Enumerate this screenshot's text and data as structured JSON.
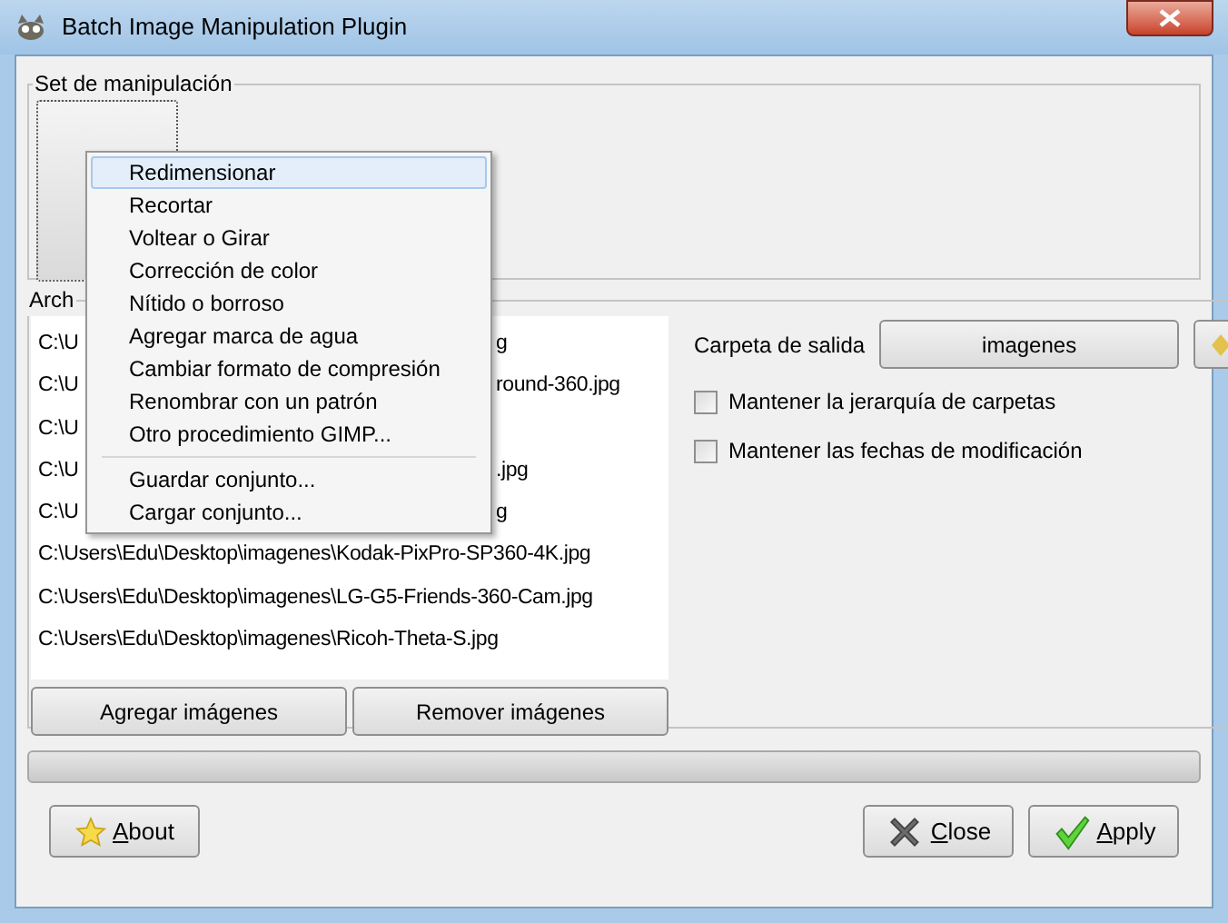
{
  "window": {
    "title": "Batch Image Manipulation Plugin"
  },
  "manipulation_set": {
    "title": "Set de manipulación"
  },
  "files": {
    "title": "Arch",
    "rows": [
      {
        "start": "C:\\U",
        "end": "g"
      },
      {
        "start": "C:\\U",
        "end": "round-360.jpg"
      },
      {
        "start": "C:\\U",
        "end": ""
      },
      {
        "start": "C:\\U",
        "end": ".jpg"
      },
      {
        "start": "C:\\U",
        "end": "g"
      },
      {
        "start": "C:\\Users\\Edu\\Desktop\\imagenes\\Kodak-PixPro-SP360-4K.jpg",
        "end": ""
      },
      {
        "start": "C:\\Users\\Edu\\Desktop\\imagenes\\LG-G5-Friends-360-Cam.jpg",
        "end": ""
      },
      {
        "start": "C:\\Users\\Edu\\Desktop\\imagenes\\Ricoh-Theta-S.jpg",
        "end": ""
      }
    ],
    "buttons": [
      "Agregar imágenes",
      "Remover imágenes"
    ]
  },
  "output": {
    "label": "Carpeta de salida",
    "folder": "imagenes",
    "options": [
      {
        "label": "Mantener la jerarquía de carpetas",
        "checked": false
      },
      {
        "label": "Mantener las fechas de modificación",
        "checked": false
      }
    ]
  },
  "progress": {
    "level": 0
  },
  "buttons": [
    {
      "kind": "about",
      "label": "About"
    },
    {
      "kind": "close",
      "label": "Close"
    },
    {
      "kind": "apply",
      "label": "Apply"
    }
  ],
  "context_menu": {
    "items": [
      {
        "kind": "item",
        "label": "Redimensionar",
        "selected": true
      },
      {
        "kind": "item",
        "label": "Recortar",
        "selected": false
      },
      {
        "kind": "item",
        "label": "Voltear o Girar",
        "selected": false
      },
      {
        "kind": "item",
        "label": "Corrección de color",
        "selected": false
      },
      {
        "kind": "item",
        "label": "Nítido o borroso",
        "selected": false
      },
      {
        "kind": "item",
        "label": "Agregar marca de agua",
        "selected": false
      },
      {
        "kind": "item",
        "label": "Cambiar formato de compresión",
        "selected": false
      },
      {
        "kind": "item",
        "label": "Renombrar con un patrón",
        "selected": false
      },
      {
        "kind": "item",
        "label": "Otro procedimiento GIMP...",
        "selected": false
      },
      {
        "kind": "separator"
      },
      {
        "kind": "item",
        "label": "Guardar conjunto...",
        "selected": false
      },
      {
        "kind": "item",
        "label": "Cargar conjunto...",
        "selected": false
      }
    ]
  }
}
